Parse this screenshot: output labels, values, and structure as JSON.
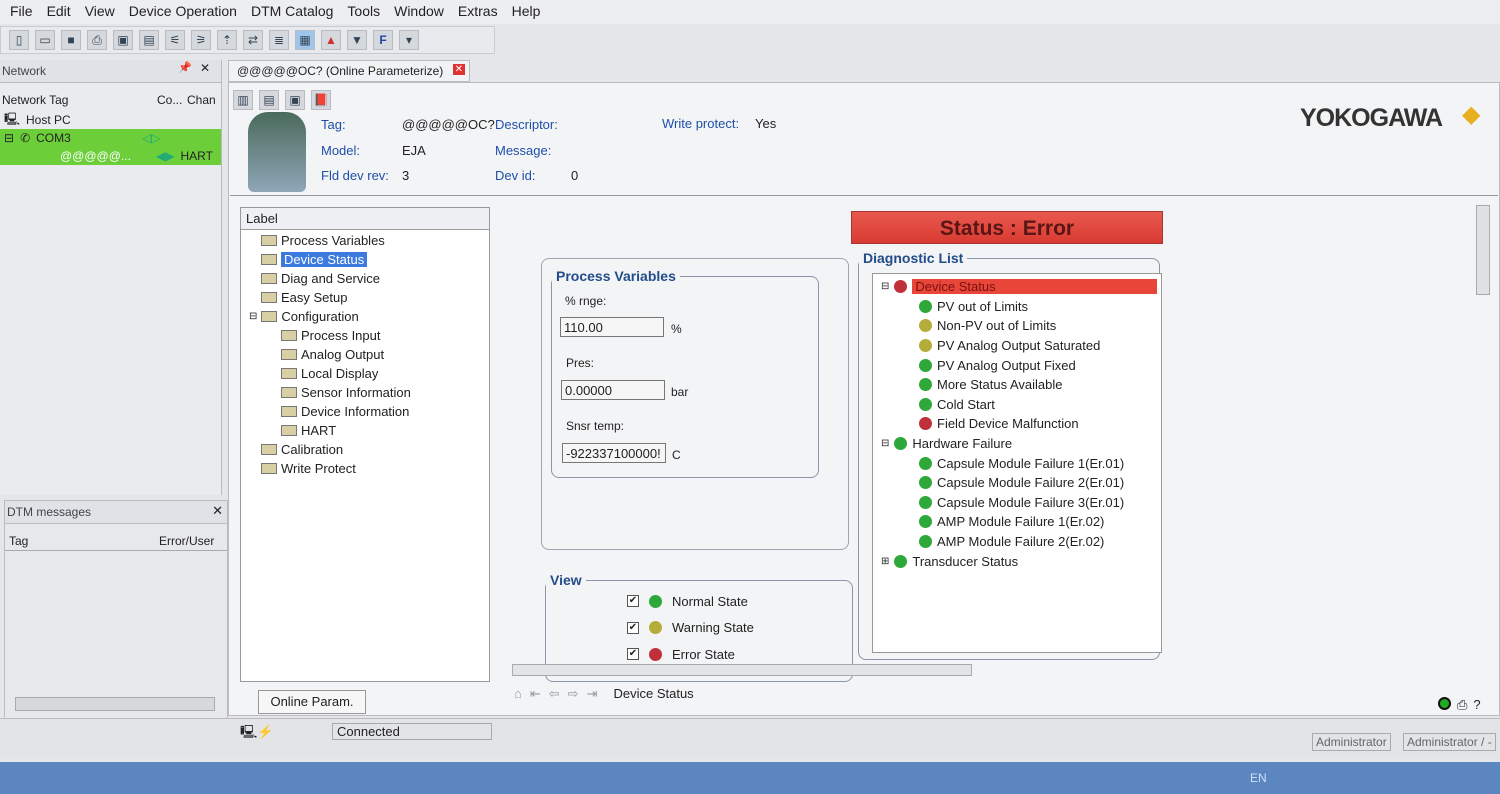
{
  "menu": [
    "File",
    "Edit",
    "View",
    "Device Operation",
    "DTM Catalog",
    "Tools",
    "Window",
    "Extras",
    "Help"
  ],
  "network": {
    "title": "Network",
    "columns": [
      "Network Tag",
      "Co...",
      "Chan"
    ],
    "rows": [
      {
        "tag": "Host PC"
      },
      {
        "tag": "COM3"
      },
      {
        "tag": "@@@@@...",
        "channel": "HART"
      }
    ]
  },
  "dtm_messages": {
    "title": "DTM messages",
    "columns": [
      "Tag",
      "Error/User"
    ]
  },
  "document_tab": "@@@@@OC? (Online Parameterize)",
  "device": {
    "tag_label": "Tag:",
    "tag": "@@@@@OC?",
    "model_label": "Model:",
    "model": "EJA",
    "rev_label": "Fld dev rev:",
    "rev": "3",
    "descriptor_label": "Descriptor:",
    "message_label": "Message:",
    "devid_label": "Dev id:",
    "devid": "0",
    "wp_label": "Write protect:",
    "wp": "Yes",
    "brand": "YOKOGAWA"
  },
  "label_tree": {
    "header": "Label",
    "items": [
      "Process Variables",
      "Device Status",
      "Diag and Service",
      "Easy Setup",
      "Configuration",
      "Process Input",
      "Analog Output",
      "Local Display",
      "Sensor Information",
      "Device Information",
      "HART",
      "Calibration",
      "Write Protect"
    ],
    "tab": "Online Param."
  },
  "pv": {
    "title": "Process Variables",
    "rnge_label": "% rnge:",
    "rnge": "110.00",
    "rnge_unit": "%",
    "pres_label": "Pres:",
    "pres": "0.00000",
    "pres_unit": "bar",
    "temp_label": "Snsr temp:",
    "temp": "-922337100000!",
    "temp_unit": "C"
  },
  "view": {
    "title": "View",
    "items": [
      "Normal State",
      "Warning State",
      "Error State"
    ]
  },
  "status": "Status : Error",
  "diag": {
    "title": "Diagnostic List",
    "items": [
      {
        "label": "Device Status",
        "state": "error",
        "level": 0
      },
      {
        "label": "PV out of Limits",
        "state": "normal",
        "level": 1
      },
      {
        "label": "Non-PV out of Limits",
        "state": "warning",
        "level": 1
      },
      {
        "label": "PV Analog Output Saturated",
        "state": "warning",
        "level": 1
      },
      {
        "label": "PV Analog Output Fixed",
        "state": "normal",
        "level": 1
      },
      {
        "label": "More Status Available",
        "state": "normal",
        "level": 1
      },
      {
        "label": "Cold Start",
        "state": "normal",
        "level": 1
      },
      {
        "label": "Field Device Malfunction",
        "state": "error",
        "level": 1
      },
      {
        "label": "Hardware Failure",
        "state": "normal",
        "level": 0
      },
      {
        "label": "Capsule Module Failure 1(Er.01)",
        "state": "normal",
        "level": 1
      },
      {
        "label": "Capsule Module Failure 2(Er.01)",
        "state": "normal",
        "level": 1
      },
      {
        "label": "Capsule Module Failure 3(Er.01)",
        "state": "normal",
        "level": 1
      },
      {
        "label": "AMP Module Failure 1(Er.02)",
        "state": "normal",
        "level": 1
      },
      {
        "label": "AMP Module Failure 2(Er.02)",
        "state": "normal",
        "level": 1
      },
      {
        "label": "Transducer Status",
        "state": "normal",
        "level": 0
      }
    ]
  },
  "colors": {
    "normal": "#2fa83a",
    "warning": "#b5ad3a",
    "error": "#c0303a",
    "accent": "#e9463a"
  },
  "nav_label": "Device Status",
  "connection": "Connected",
  "users": [
    "Administrator",
    "Administrator / -"
  ],
  "taskbar": {
    "lang": "EN"
  }
}
